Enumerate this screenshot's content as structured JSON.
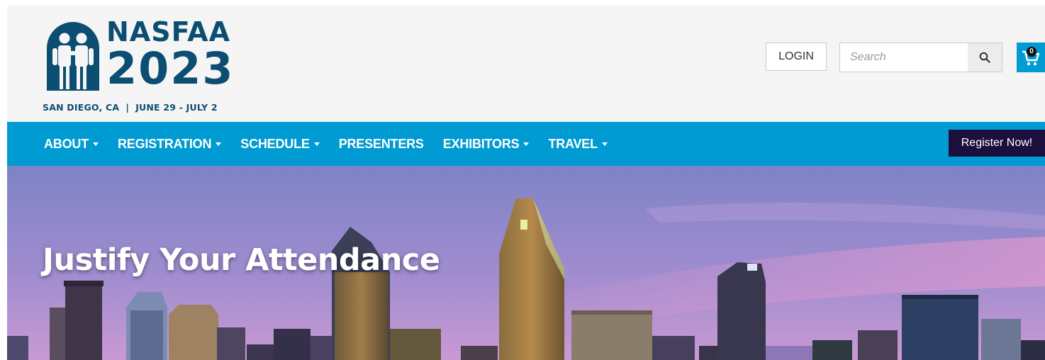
{
  "header": {
    "logo": {
      "word": "NASFAA",
      "year": "2023",
      "tagline": "SAN DIEGO, CA  |  JUNE 29 - JULY 2"
    },
    "login_label": "LOGIN",
    "search": {
      "placeholder": "Search",
      "value": ""
    },
    "cart_count": "0"
  },
  "nav": {
    "items": [
      {
        "label": "ABOUT",
        "has_dropdown": true
      },
      {
        "label": "REGISTRATION",
        "has_dropdown": true
      },
      {
        "label": "SCHEDULE",
        "has_dropdown": true
      },
      {
        "label": "PRESENTERS",
        "has_dropdown": false
      },
      {
        "label": "EXHIBITORS",
        "has_dropdown": true
      },
      {
        "label": "TRAVEL",
        "has_dropdown": true
      }
    ],
    "register_label": "Register Now!"
  },
  "hero": {
    "title": "Justify Your Attendance"
  },
  "icons": {
    "search": "search-icon",
    "cart": "cart-icon",
    "dropdown": "caret-down-icon",
    "logo": "people-logo-icon"
  },
  "colors": {
    "brand_dark": "#0c4e72",
    "nav_blue": "#009bd2",
    "register_bg": "#1b0f3e",
    "header_bg": "#f5f5f5"
  }
}
